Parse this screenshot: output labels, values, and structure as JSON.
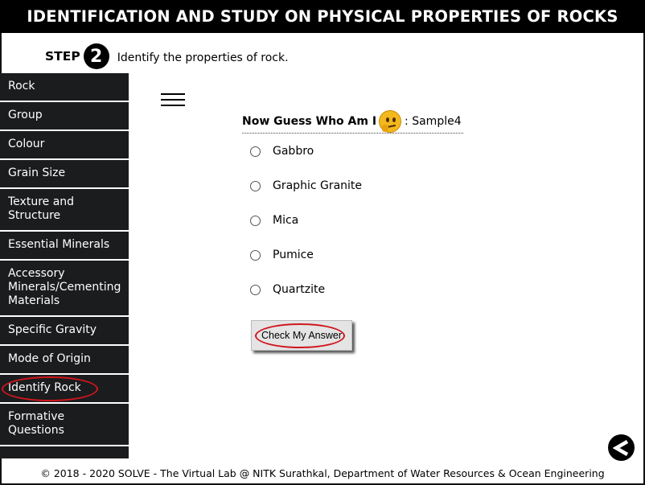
{
  "title": "IDENTIFICATION AND STUDY ON PHYSICAL PROPERTIES OF ROCKS",
  "step": {
    "label": "STEP",
    "number": "2",
    "instruction": "Identify the properties of rock."
  },
  "sidebar": {
    "items": [
      {
        "label": "Rock"
      },
      {
        "label": "Group"
      },
      {
        "label": "Colour"
      },
      {
        "label": "Grain Size"
      },
      {
        "label": "Texture and Structure"
      },
      {
        "label": "Essential Minerals"
      },
      {
        "label": "Accessory Minerals/Cementing Materials"
      },
      {
        "label": "Specific Gravity"
      },
      {
        "label": "Mode of Origin"
      },
      {
        "label": "Identify Rock",
        "highlighted": true
      },
      {
        "label": "Formative Questions"
      }
    ]
  },
  "quiz": {
    "heading": "Now Guess Who Am I",
    "sample": ": Sample4",
    "options": [
      "Gabbro",
      "Graphic Granite",
      "Mica",
      "Pumice",
      "Quartzite"
    ],
    "button_label": "Check My Answer"
  },
  "icons": {
    "menu": "hamburger-icon",
    "emoji": "thinking-face-icon",
    "back": "back-arrow-icon"
  },
  "colors": {
    "title_bg": "#000000",
    "sidebar_bg": "#1b1c1e",
    "highlight": "#d0161e"
  },
  "footer": "© 2018 - 2020 SOLVE - The Virtual Lab @ NITK Surathkal, Department of Water Resources & Ocean Engineering"
}
